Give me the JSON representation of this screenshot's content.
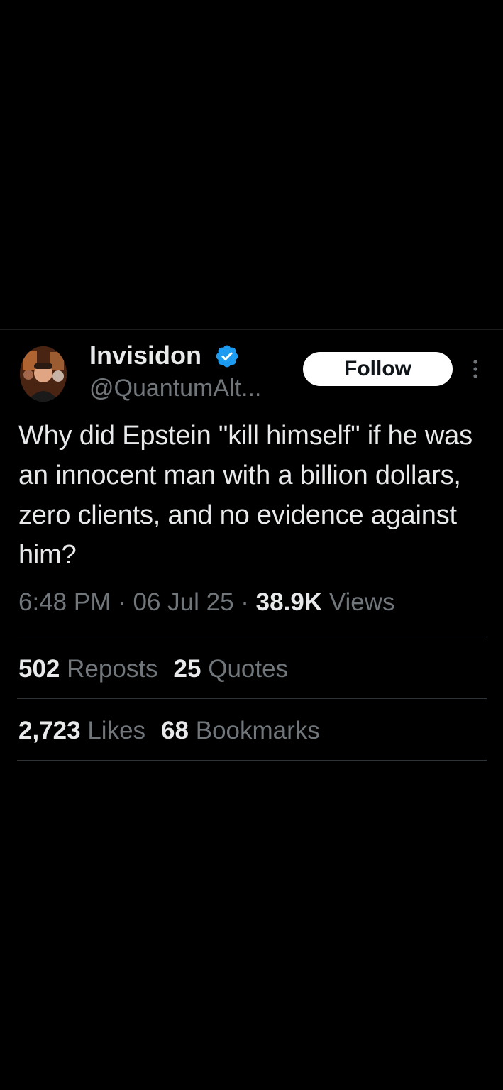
{
  "tweet": {
    "author": {
      "display_name": "Invisidon",
      "handle": "@QuantumAlt...",
      "verified": true
    },
    "follow_label": "Follow",
    "text": "Why did Epstein \"kill himself\" if he was an innocent man with a billion dollars, zero clients, and no evidence against him?",
    "meta": {
      "time": "6:48 PM",
      "separator": "·",
      "date": "06 Jul 25",
      "views_count": "38.9K",
      "views_label": "Views"
    },
    "stats": {
      "reposts_count": "502",
      "reposts_label": "Reposts",
      "quotes_count": "25",
      "quotes_label": "Quotes",
      "likes_count": "2,723",
      "likes_label": "Likes",
      "bookmarks_count": "68",
      "bookmarks_label": "Bookmarks"
    }
  },
  "colors": {
    "background": "#000000",
    "primary_text": "#e7e9ea",
    "secondary_text": "#71767b",
    "verified_blue": "#1d9bf0",
    "divider": "#2f3336",
    "follow_bg": "#ffffff"
  },
  "icons": [
    "verified-badge-icon",
    "more-options-icon"
  ]
}
